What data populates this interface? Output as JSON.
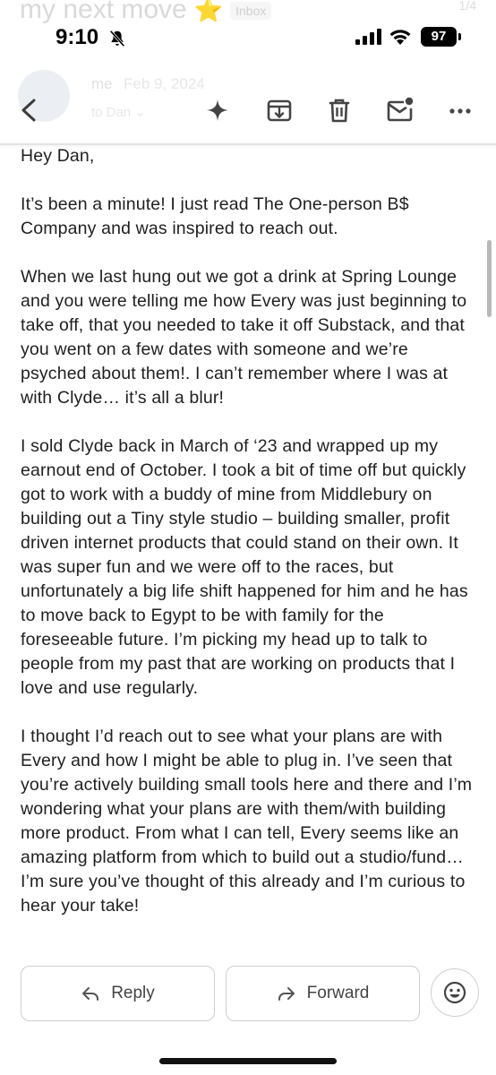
{
  "status": {
    "time": "9:10",
    "battery": "97",
    "icons": [
      "bell-slash-icon",
      "cellular-signal-icon",
      "wifi-icon",
      "battery-icon"
    ]
  },
  "ghost": {
    "subject": "my next move",
    "subject_emoji": "⭐",
    "label": "Inbox",
    "sender": "me",
    "date": "Feb 9, 2024",
    "to": "to Dan ⌄"
  },
  "toolbar": {
    "icons": [
      "back-arrow-icon",
      "sparkle-icon",
      "archive-icon",
      "trash-icon",
      "mark-unread-icon",
      "more-icon"
    ]
  },
  "email": {
    "paragraphs": [
      "Hey Dan,",
      "It’s been a minute! I just read The One-person B$ Company and was inspired to reach out.",
      "When we last hung out we got a drink at Spring Lounge and you were telling me how Every was just beginning to take off, that you needed to take it off Substack, and that you went on a few dates with someone and we’re psyched about them!. I can’t remember where I was at with Clyde… it’s all a blur!",
      "I sold Clyde back in March of ‘23 and wrapped up my earnout end of October. I took a bit of time off but quickly got to work with a buddy of mine from Middlebury on building out a Tiny style studio – building smaller, profit driven internet products that could stand on their own. It was super fun and we were off to the races, but unfortunately a big life shift happened for him and he has to move back to Egypt to be with family for the foreseeable future. I’m picking my head up to talk to people from my past that are working on products that I love and use regularly.",
      "I thought I’d reach out to see what your plans are with Every and how I might be able to plug in. I’ve seen that you’re actively building small tools here and there and I’m wondering what your plans are with them/with building more product. From what I can tell, Every seems like an amazing platform from which to build out a studio/fund… I’m sure you’ve thought of this already and I’m curious to hear your take!"
    ]
  },
  "actions": {
    "reply_label": "Reply",
    "forward_label": "Forward",
    "emoji_icon": "add-reaction-icon"
  },
  "colors": {
    "text": "#1f1f1f",
    "button_border": "#cfcfcf",
    "muted": "#444444"
  }
}
